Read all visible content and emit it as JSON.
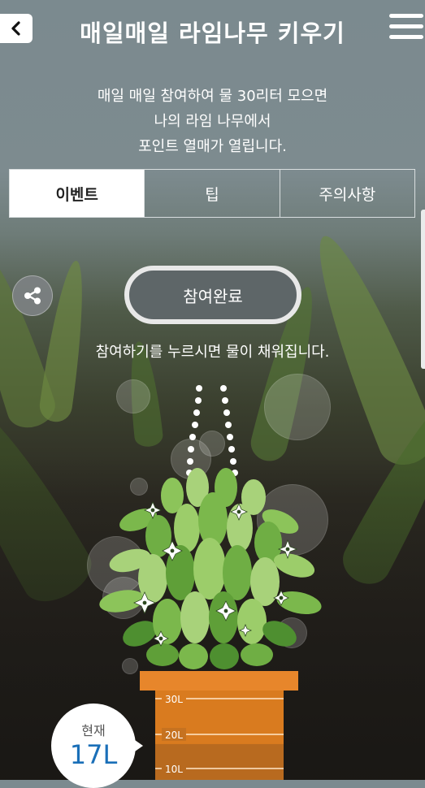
{
  "header": {
    "title": "매일매일 라임나무 키우기",
    "back_icon": "chevron-left-icon",
    "menu_icon": "hamburger-menu-icon"
  },
  "description": {
    "lines": [
      "매일 매일 참여하여 물 30리터 모으면",
      "나의 라임 나무에서",
      "포인트 열매가 열립니다."
    ]
  },
  "tabs": [
    {
      "label": "이벤트",
      "active": true
    },
    {
      "label": "팁",
      "active": false
    },
    {
      "label": "주의사항",
      "active": false
    }
  ],
  "share": {
    "icon": "share-icon"
  },
  "participate_button": {
    "label": "참여완료"
  },
  "guide_text": "참여하기를 누르시면 물이 채워집니다.",
  "gauge": {
    "marks": [
      "30L",
      "20L",
      "10L"
    ],
    "current_label": "현재",
    "current_value": "17L",
    "level_liters": 17,
    "max_liters": 30
  },
  "colors": {
    "pot": "#d97b1f",
    "pot_rim": "#e7862b",
    "water": "#b86a1f",
    "leaf_light": "#a8d27a",
    "leaf_mid": "#7bb84c",
    "leaf_dark": "#4e8f30",
    "current_value": "#1a6fb8"
  }
}
